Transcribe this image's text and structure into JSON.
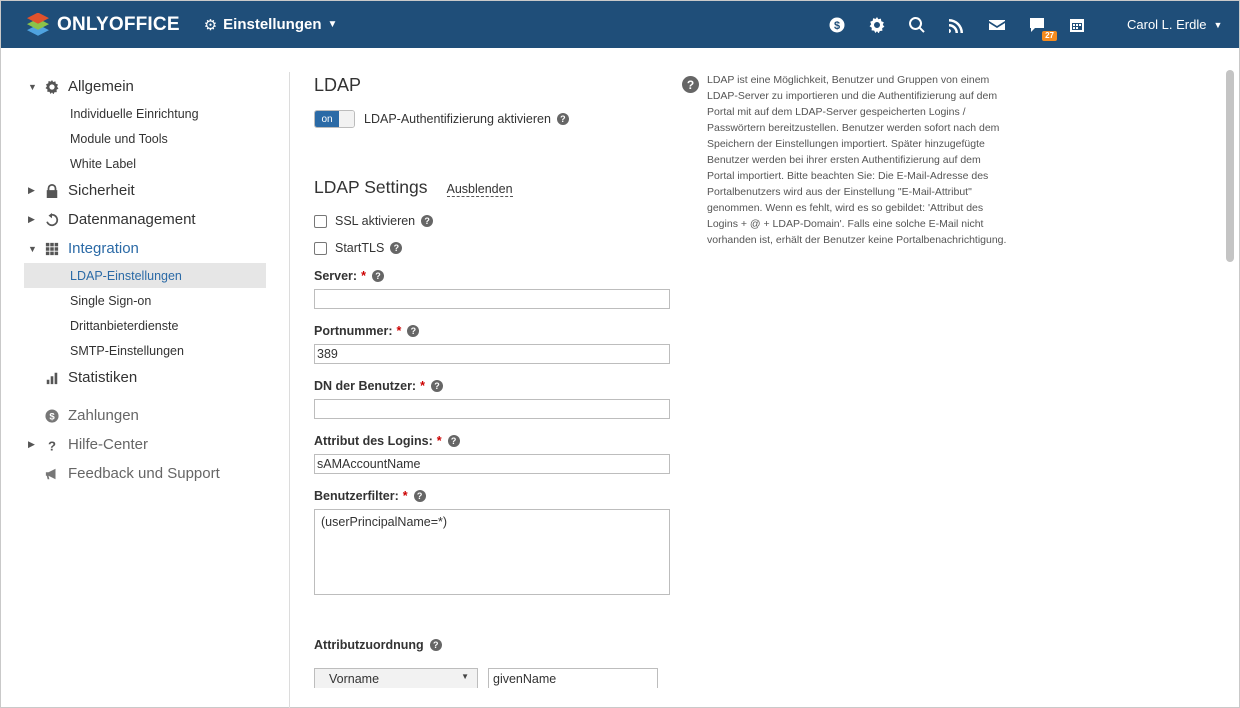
{
  "app": {
    "brand": "ONLYOFFICE",
    "module": "Einstellungen",
    "user": "Carol L. Erdle",
    "chat_badge": "27"
  },
  "topbar_icons": [
    "payments-icon",
    "settings-icon",
    "search-icon",
    "feed-icon",
    "mail-icon",
    "chat-icon",
    "calendar-icon"
  ],
  "sidebar": {
    "general": "Allgemein",
    "general_items": [
      "Individuelle Einrichtung",
      "Module und Tools",
      "White Label"
    ],
    "security": "Sicherheit",
    "data": "Datenmanagement",
    "integration": "Integration",
    "integration_items": [
      "LDAP-Einstellungen",
      "Single Sign-on",
      "Drittanbieterdienste",
      "SMTP-Einstellungen"
    ],
    "statistics": "Statistiken",
    "payments": "Zahlungen",
    "help": "Hilfe-Center",
    "feedback": "Feedback und Support"
  },
  "main": {
    "title": "LDAP",
    "toggle_state": "on",
    "toggle_label": "LDAP-Authentifizierung aktivieren",
    "settings_title": "LDAP Settings",
    "hide_link": "Ausblenden",
    "ssl_label": "SSL aktivieren",
    "starttls_label": "StartTLS",
    "server_label": "Server:",
    "server_value": "",
    "port_label": "Portnummer:",
    "port_value": "389",
    "dn_label": "DN der Benutzer:",
    "dn_value": "",
    "login_attr_label": "Attribut des Logins:",
    "login_attr_value": "sAMAccountName",
    "filter_label": "Benutzerfilter:",
    "filter_value": "(userPrincipalName=*)",
    "mapping_label": "Attributzuordnung",
    "mapping_select": "Vorname",
    "mapping_value": "givenName"
  },
  "help_text": "LDAP ist eine Möglichkeit, Benutzer und Gruppen von einem LDAP-Server zu importieren und die Authentifizierung auf dem Portal mit auf dem LDAP-Server gespeicherten Logins / Passwörtern bereitzustellen. Benutzer werden sofort nach dem Speichern der Einstellungen importiert. Später hinzugefügte Benutzer werden bei ihrer ersten Authentifizierung auf dem Portal importiert. Bitte beachten Sie: Die E-Mail-Adresse des Portalbenutzers wird aus der Einstellung \"E-Mail-Attribut\" genommen. Wenn es fehlt, wird es so gebildet: 'Attribut des Logins + @ + LDAP-Domain'. Falls eine solche E-Mail nicht vorhanden ist, erhält der Benutzer keine Portalbenachrichtigung."
}
